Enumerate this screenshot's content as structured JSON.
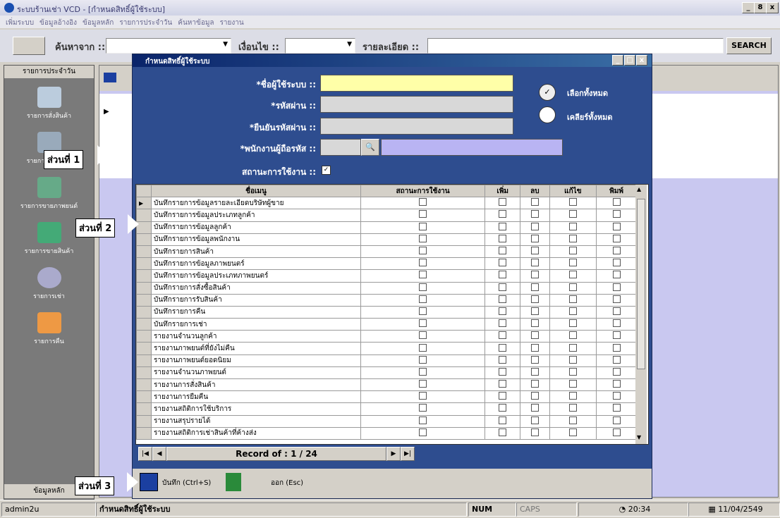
{
  "window": {
    "title": "ระบบร้านเช่า VCD - [กำหนดสิทธิ์ผู้ใช้ระบบ]",
    "min": "_",
    "max": "8",
    "close": "x"
  },
  "menu": [
    "เพิ่มระบบ",
    "ข้อมูลอ้างอิง",
    "ข้อมูลหลัก",
    "รายการประจำวัน",
    "ค้นหาข้อมูล",
    "รายงาน"
  ],
  "toolbar": {
    "search_from_label": "ค้นหาจาก ::",
    "condition_label": "เงื่อนไข ::",
    "detail_label": "รายละเอียด ::",
    "search_button": "SEARCH"
  },
  "leftnav": {
    "header": "รายการประจำวัน",
    "items": [
      "รายการสั่งสินค้า",
      "รายการรับสินค้า",
      "รายการขายภาพยนต์",
      "รายการขายสินค้า",
      "รายการเช่า",
      "รายการคืน"
    ],
    "footer": "ข้อมูลหลัก"
  },
  "dialog": {
    "title": "กำหนดสิทธิ์ผู้ใช้ระบบ",
    "username_label": "*ชื่อผู้ใช้ระบบ ::",
    "password_label": "*รหัสผ่าน ::",
    "confirm_label": "*ยืนยันรหัสผ่าน ::",
    "employee_label": "*พนักงานผู้ถือรหัส ::",
    "status_label": "สถานะการใช้งาน ::",
    "select_all": "เลือกทั้งหมด",
    "clear_all": "เคลียร์ทั้งหมด",
    "columns": [
      "ชื่อเมนู",
      "สถานะการใช้งาน",
      "เพิ่ม",
      "ลบ",
      "แก้ไข",
      "พิมพ์"
    ],
    "rows": [
      "บันทึกรายการข้อมูลรายละเอียดบริษัทผู้ขาย",
      "บันทึกรายการข้อมูลประเภทลูกค้า",
      "บันทึกรายการข้อมูลลูกค้า",
      "บันทึกรายการข้อมูลพนักงาน",
      "บันทึกรายการสินค้า",
      "บันทึกรายการข้อมูลภาพยนตร์",
      "บันทึกรายการข้อมูลประเภทภาพยนตร์",
      "บันทึกรายการสั่งซื้อสินค้า",
      "บันทึกรายการรับสินค้า",
      "บันทึกรายการคืน",
      "บันทึกรายการเช่า",
      "รายงานจำนวนลูกค้า",
      "รายงานภาพยนต์ที่ยังไม่คืน",
      "รายงานภาพยนต์ยอดนิยม",
      "รายงานจำนวนภาพยนต์",
      "รายงานการสั่งสินค้า",
      "รายงานการยืมคืน",
      "รายงานสถิติการใช้บริการ",
      "รายงานสรุปรายได้",
      "รายงานสถิติการเช่าสินค้าที่ค้างส่ง"
    ],
    "record_text": "Record of : 1 / 24",
    "save_label": "บันทึก (Ctrl+S)",
    "exit_label": "ออก (Esc)"
  },
  "callouts": [
    "ส่วนที่ 1",
    "ส่วนที่ 2",
    "ส่วนที่ 3"
  ],
  "statusbar": {
    "user": "admin2u",
    "screen": "กำหนดสิทธิ์ผู้ใช้ระบบ",
    "num": "NUM",
    "caps": "CAPS",
    "time": "20:34",
    "date": "11/04/2549"
  }
}
